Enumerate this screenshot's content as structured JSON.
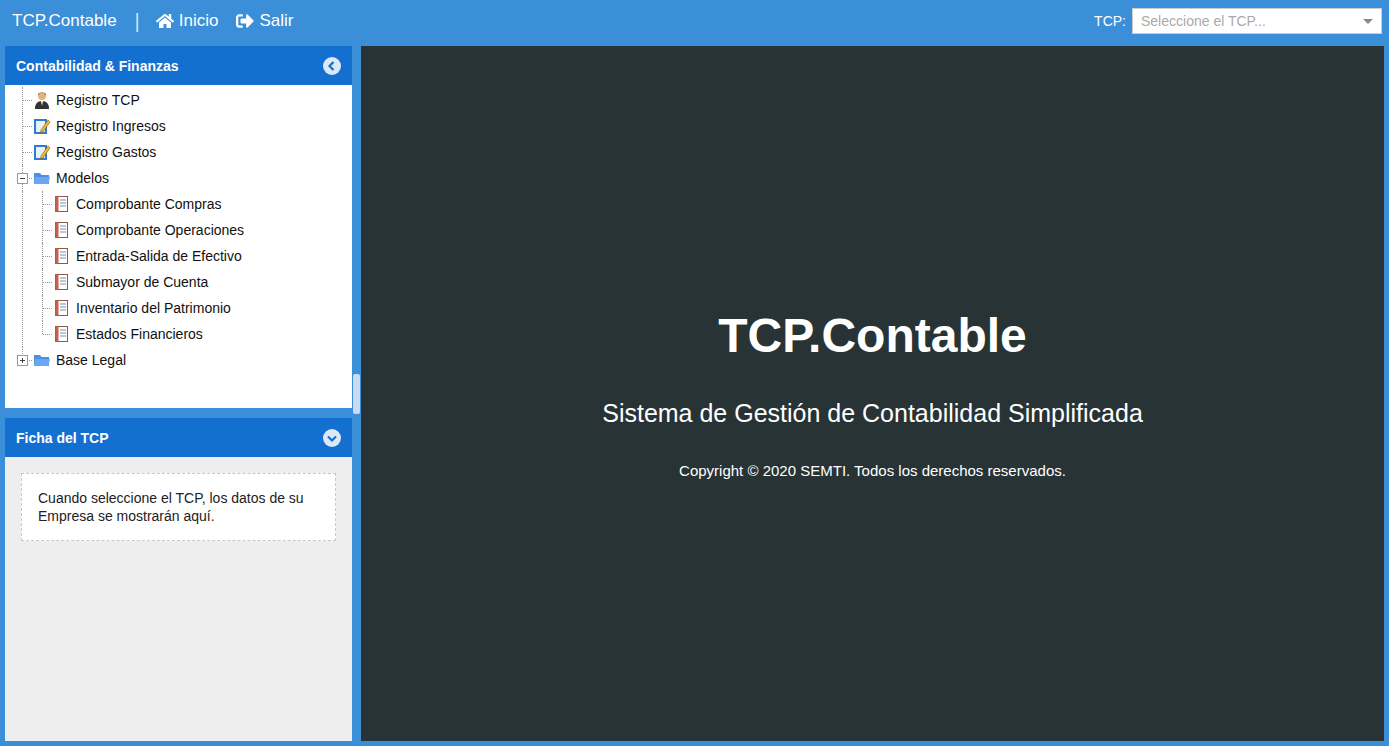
{
  "app": {
    "title": "TCP.Contable",
    "separator": "|"
  },
  "nav": [
    {
      "label": "Inicio"
    },
    {
      "label": "Salir"
    }
  ],
  "tcp_selector": {
    "label": "TCP:",
    "placeholder": "Seleccione el TCP..."
  },
  "sidebar": {
    "title": "Contabilidad & Finanzas",
    "items": [
      {
        "label": "Registro TCP",
        "kind": "person"
      },
      {
        "label": "Registro Ingresos",
        "kind": "edit"
      },
      {
        "label": "Registro Gastos",
        "kind": "edit"
      },
      {
        "label": "Modelos",
        "kind": "folder",
        "expanded": true,
        "children": [
          {
            "label": "Comprobante Compras",
            "kind": "document"
          },
          {
            "label": "Comprobante Operaciones",
            "kind": "document"
          },
          {
            "label": "Entrada-Salida de Efectivo",
            "kind": "document"
          },
          {
            "label": "Submayor de Cuenta",
            "kind": "document"
          },
          {
            "label": "Inventario del Patrimonio",
            "kind": "document"
          },
          {
            "label": "Estados Financieros",
            "kind": "document"
          }
        ]
      },
      {
        "label": "Base Legal",
        "kind": "folder",
        "expanded": false,
        "children": []
      }
    ]
  },
  "card": {
    "title": "Ficha del TCP",
    "message": "Cuando seleccione el TCP, los datos de su Empresa se mostrarán aquí."
  },
  "hero": {
    "title": "TCP.Contable",
    "subtitle": "Sistema de Gestión de Contabilidad Simplificada",
    "copyright": "Copyright © 2020 SEMTI. Todos los derechos reservados."
  }
}
